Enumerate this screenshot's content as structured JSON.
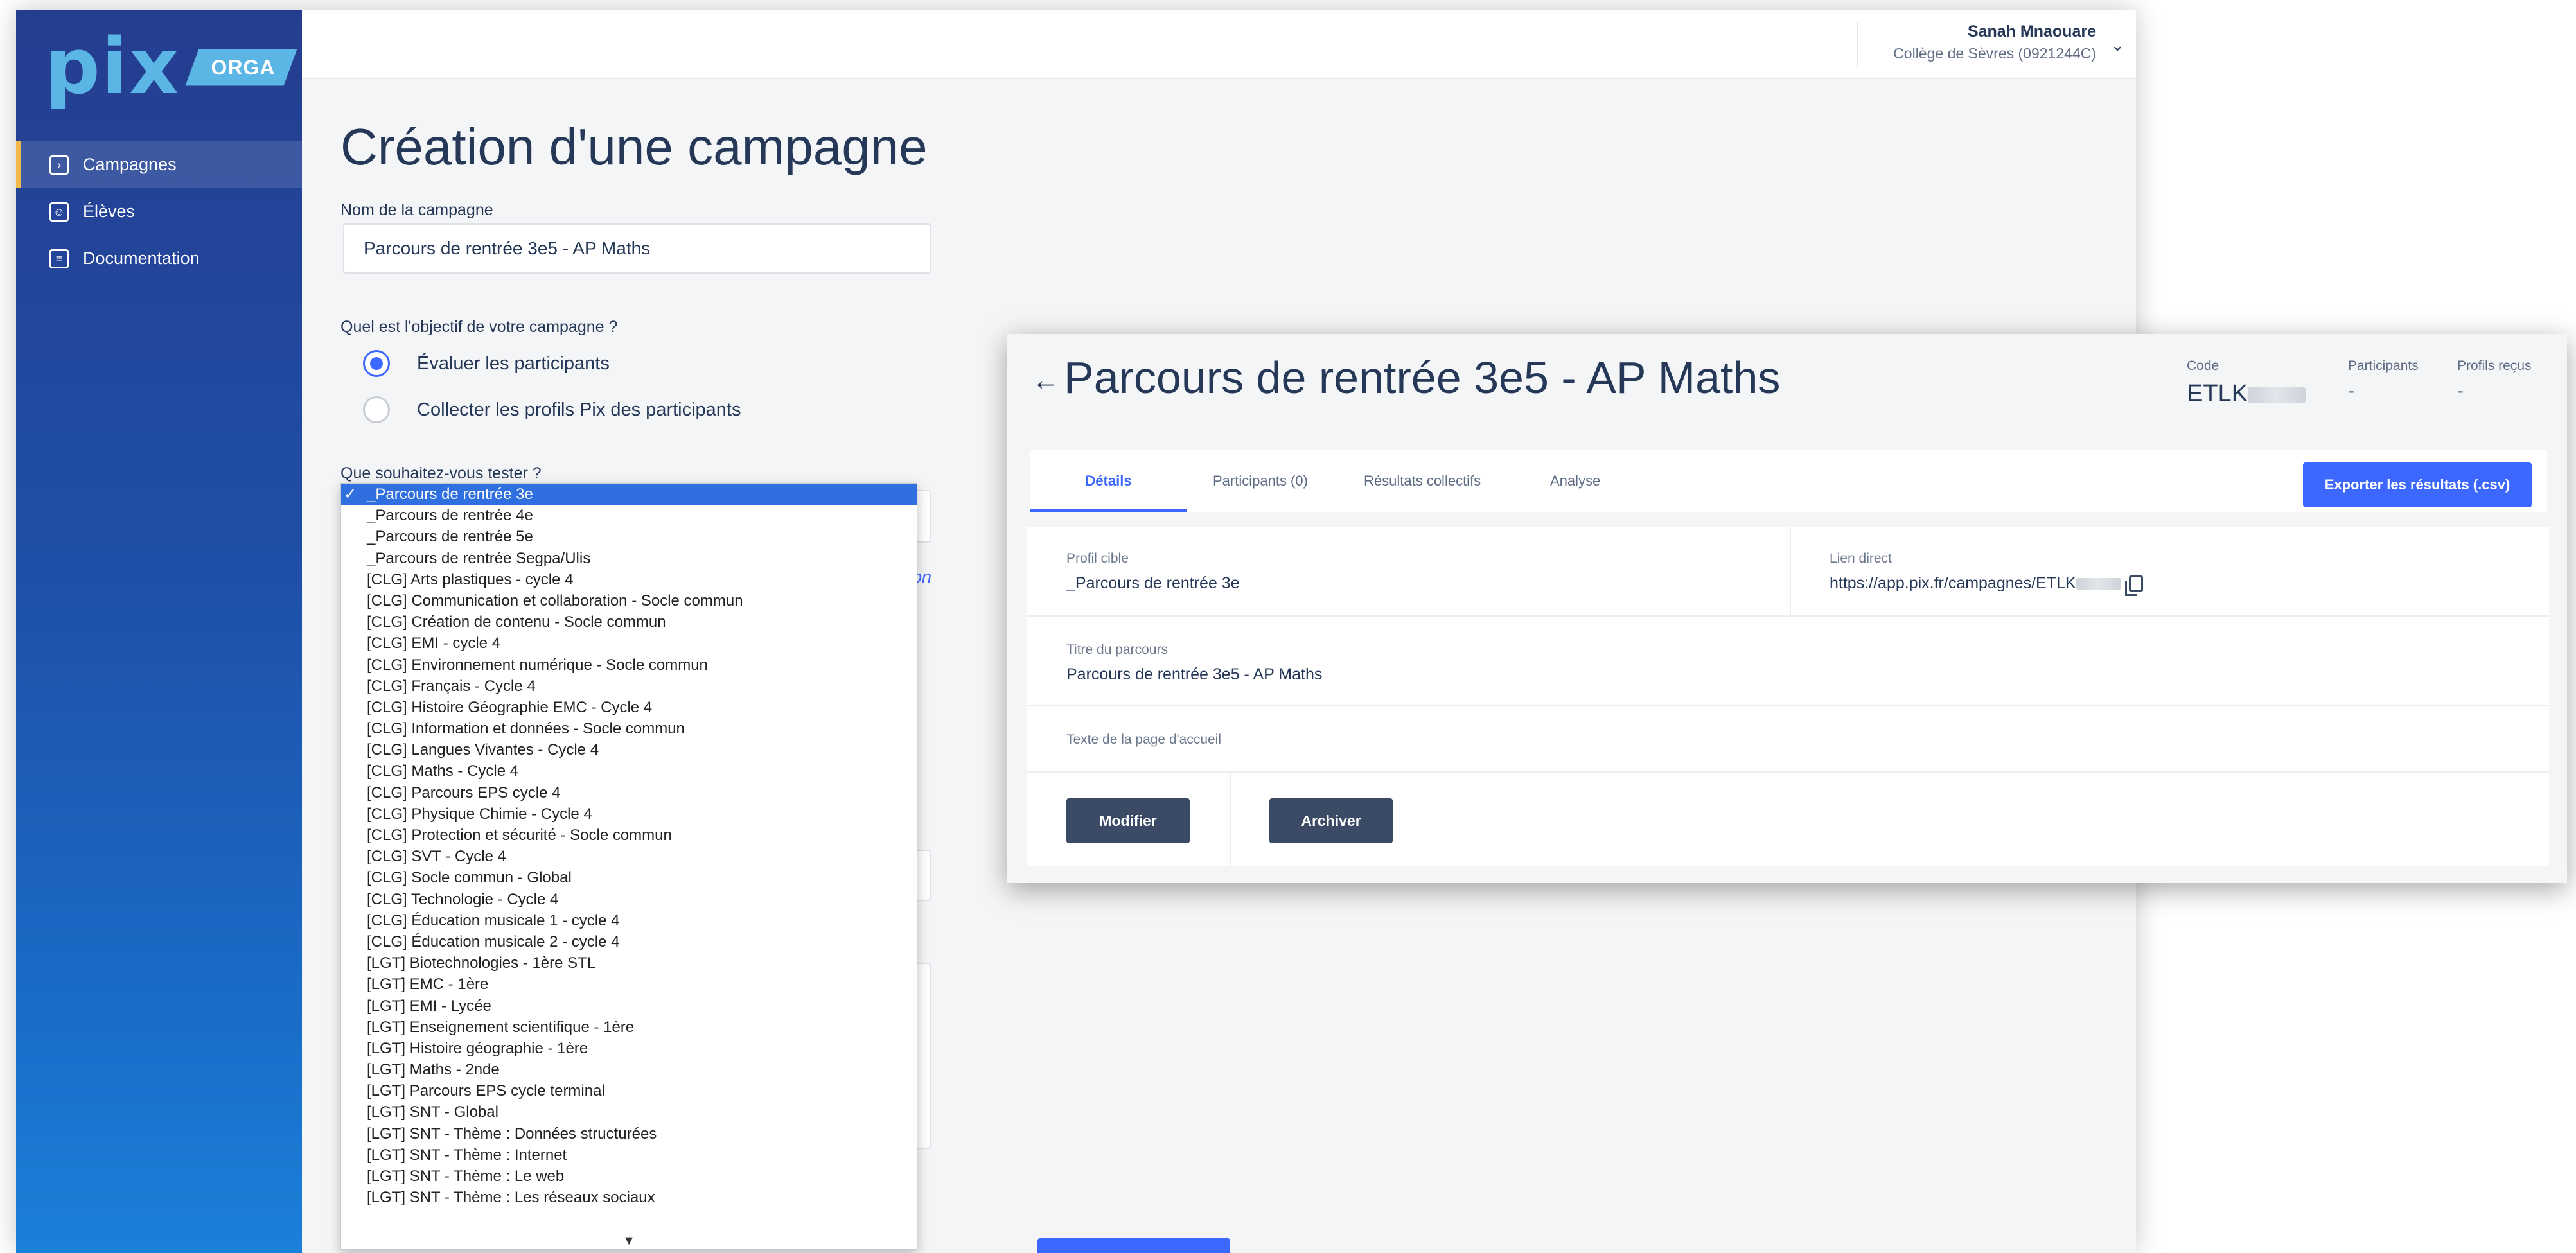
{
  "app": {
    "logo_text": "pix",
    "logo_badge": "ORGA",
    "nav": [
      {
        "label": "Campagnes",
        "icon": "campaign-icon"
      },
      {
        "label": "Élèves",
        "icon": "students-icon"
      },
      {
        "label": "Documentation",
        "icon": "book-icon"
      }
    ],
    "user": {
      "name": "Sanah Mnaouare",
      "organization": "Collège de Sèvres (0921244C)"
    }
  },
  "form": {
    "title": "Création d'une campagne",
    "name_label": "Nom de la campagne",
    "name_value": "Parcours de rentrée 3e5 - AP Maths",
    "goal_label": "Quel est l'objectif de votre campagne ?",
    "goal_options": [
      {
        "label": "Évaluer les participants",
        "checked": true
      },
      {
        "label": "Collecter les profils Pix des participants",
        "checked": false
      }
    ],
    "test_label": "Que souhaitez-vous tester ?",
    "link_fragment": "on"
  },
  "dropdown": {
    "selected_index": 0,
    "options": [
      "_Parcours de rentrée 3e",
      "_Parcours de rentrée 4e",
      "_Parcours de rentrée 5e",
      "_Parcours de rentrée Segpa/Ulis",
      "[CLG] Arts plastiques - cycle 4",
      "[CLG] Communication et collaboration - Socle commun",
      "[CLG] Création de contenu - Socle commun",
      "[CLG] EMI - cycle 4",
      "[CLG] Environnement numérique - Socle commun",
      "[CLG] Français - Cycle 4",
      "[CLG] Histoire Géographie EMC - Cycle 4",
      "[CLG] Information et données - Socle commun",
      "[CLG] Langues Vivantes - Cycle 4",
      "[CLG] Maths - Cycle 4",
      "[CLG] Parcours EPS cycle 4",
      "[CLG] Physique Chimie - Cycle 4",
      "[CLG] Protection et sécurité - Socle commun",
      "[CLG] SVT - Cycle 4",
      "[CLG] Socle commun - Global",
      "[CLG] Technologie - Cycle 4",
      "[CLG] Éducation musicale 1 - cycle 4",
      "[CLG] Éducation musicale 2 - cycle 4",
      "[LGT] Biotechnologies - 1ère STL",
      "[LGT] EMC - 1ère",
      "[LGT] EMI - Lycée",
      "[LGT] Enseignement scientifique - 1ère",
      "[LGT] Histoire géographie - 1ère",
      "[LGT] Maths - 2nde",
      "[LGT] Parcours EPS cycle terminal",
      "[LGT] SNT - Global",
      "[LGT] SNT - Thème : Données structurées",
      "[LGT] SNT - Thème : Internet",
      "[LGT] SNT - Thème : Le web",
      "[LGT] SNT - Thème : Les réseaux sociaux"
    ],
    "check_glyph": "✓",
    "scroll_glyph": "▼"
  },
  "campaign": {
    "back_glyph": "←",
    "title": "Parcours de rentrée 3e5 - AP Maths",
    "stats": [
      {
        "label": "Code",
        "value": "ETLK"
      },
      {
        "label": "Participants",
        "value": "-"
      },
      {
        "label": "Profils reçus",
        "value": "-"
      }
    ],
    "tabs": [
      "Détails",
      "Participants (0)",
      "Résultats collectifs",
      "Analyse"
    ],
    "export_label": "Exporter les résultats (.csv)",
    "target_profile_label": "Profil cible",
    "target_profile_value": "_Parcours de rentrée 3e",
    "direct_link_label": "Lien direct",
    "direct_link_value": "https://app.pix.fr/campagnes/ETLK",
    "course_title_label": "Titre du parcours",
    "course_title_value": "Parcours de rentrée 3e5 - AP Maths",
    "welcome_text_label": "Texte de la page d'accueil",
    "modify_label": "Modifier",
    "archive_label": "Archiver"
  },
  "colors": {
    "primary": "#3d68ff",
    "sidebar": "#253d8f",
    "logo": "#5bb6e6",
    "dark_button": "#3b4b66"
  }
}
